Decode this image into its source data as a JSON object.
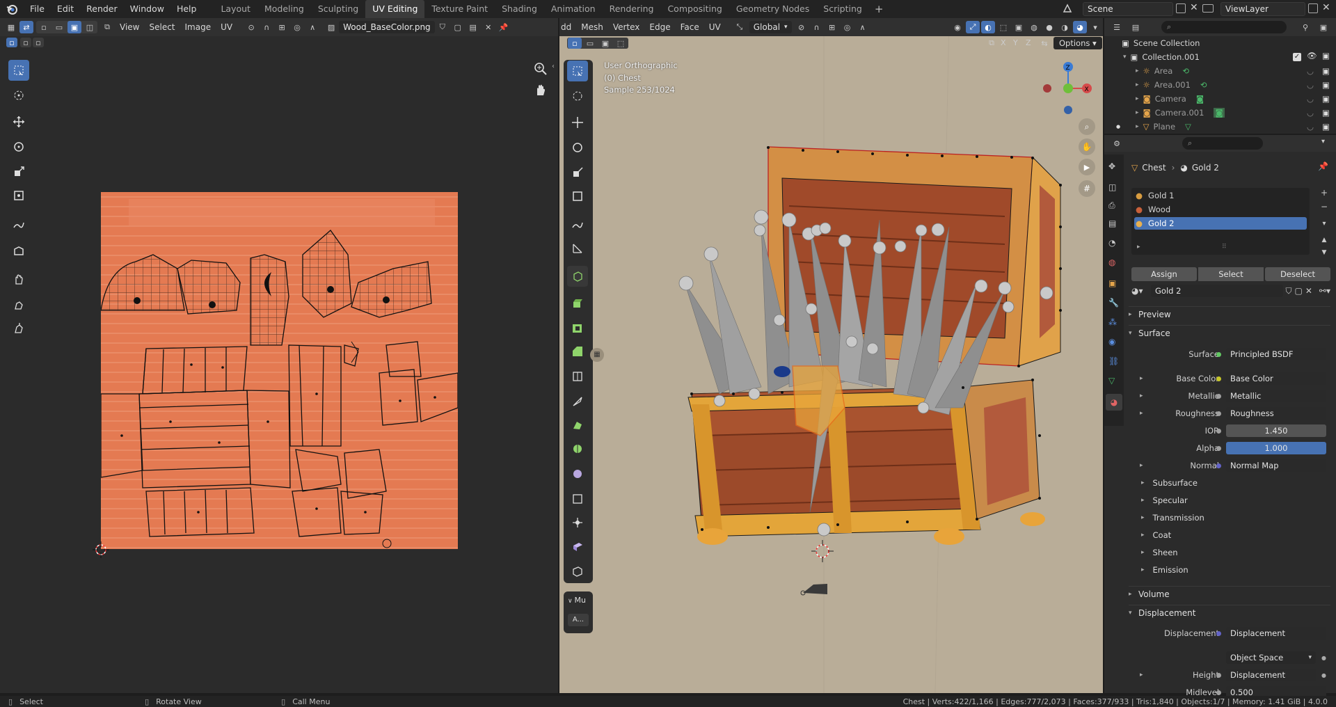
{
  "menubar": {
    "items": [
      "File",
      "Edit",
      "Render",
      "Window",
      "Help"
    ],
    "workspaces": [
      "Layout",
      "Modeling",
      "Sculpting",
      "UV Editing",
      "Texture Paint",
      "Shading",
      "Animation",
      "Rendering",
      "Compositing",
      "Geometry Nodes",
      "Scripting"
    ],
    "active_workspace": "UV Editing",
    "scene": "Scene",
    "view_layer": "ViewLayer"
  },
  "uv_editor": {
    "menus": [
      "View",
      "Select",
      "Image",
      "UV"
    ],
    "image_name": "Wood_BaseColor.png"
  },
  "viewport": {
    "menus": [
      "dd",
      "Mesh",
      "Vertex",
      "Edge",
      "Face",
      "UV"
    ],
    "orientation": "Global",
    "axes": [
      "X",
      "Y",
      "Z"
    ],
    "options_label": "Options",
    "overlay_info": [
      "User Orthographic",
      "(0) Chest",
      "Sample 253/1024"
    ],
    "collapsed_panel": "Mu",
    "collapsed_panel_btn": "A..."
  },
  "outliner": {
    "root": "Scene Collection",
    "collection": "Collection.001",
    "objects": [
      "Area",
      "Area.001",
      "Camera",
      "Camera.001",
      "Plane"
    ]
  },
  "properties": {
    "breadcrumb_object": "Chest",
    "breadcrumb_material": "Gold 2",
    "slots": [
      "Gold 1",
      "Wood",
      "Gold 2"
    ],
    "active_slot": "Gold 2",
    "slot_buttons": [
      "Assign",
      "Select",
      "Deselect"
    ],
    "material_name": "Gold 2",
    "sections": {
      "preview": "Preview",
      "surface": "Surface",
      "volume": "Volume",
      "displacement": "Displacement"
    },
    "surface_rows": [
      {
        "label": "Surface",
        "value": "Principled BSDF",
        "socket": "#63c763",
        "arrow": false
      },
      {
        "label": "Base Color",
        "value": "Base Color",
        "socket": "#c7c729",
        "arrow": true
      },
      {
        "label": "Metallic",
        "value": "Metallic",
        "socket": "#a1a1a1",
        "arrow": true
      },
      {
        "label": "Roughness",
        "value": "Roughness",
        "socket": "#a1a1a1",
        "arrow": true
      },
      {
        "label": "IOR",
        "value": "1.450",
        "socket": "#a1a1a1",
        "arrow": false
      },
      {
        "label": "Alpha",
        "value": "1.000",
        "socket": "#a1a1a1",
        "arrow": false
      },
      {
        "label": "Normal",
        "value": "Normal Map",
        "socket": "#6363c7",
        "arrow": true
      }
    ],
    "subpanels": [
      "Subsurface",
      "Specular",
      "Transmission",
      "Coat",
      "Sheen",
      "Emission"
    ],
    "displacement_rows": [
      {
        "label": "Displacement",
        "value": "Displacement",
        "socket": "#6363c7"
      },
      {
        "label": "",
        "value": "Object Space",
        "socket": ""
      },
      {
        "label": "Height",
        "value": "Displacement",
        "socket": "#a1a1a1"
      },
      {
        "label": "Midlevel",
        "value": "0.500",
        "socket": "#a1a1a1"
      }
    ]
  },
  "statusbar": {
    "hints": [
      "Select",
      "Rotate View",
      "Call Menu"
    ],
    "stats": "Chest | Verts:422/1,166 | Edges:777/2,073 | Faces:377/933 | Tris:1,840 | Objects:1/7 | Memory: 1.41 GiB | 4.0.0"
  },
  "colors": {
    "accent": "#4772b3",
    "uv_texture": "#e47a52",
    "viewport_bg": "#b9ad98"
  }
}
